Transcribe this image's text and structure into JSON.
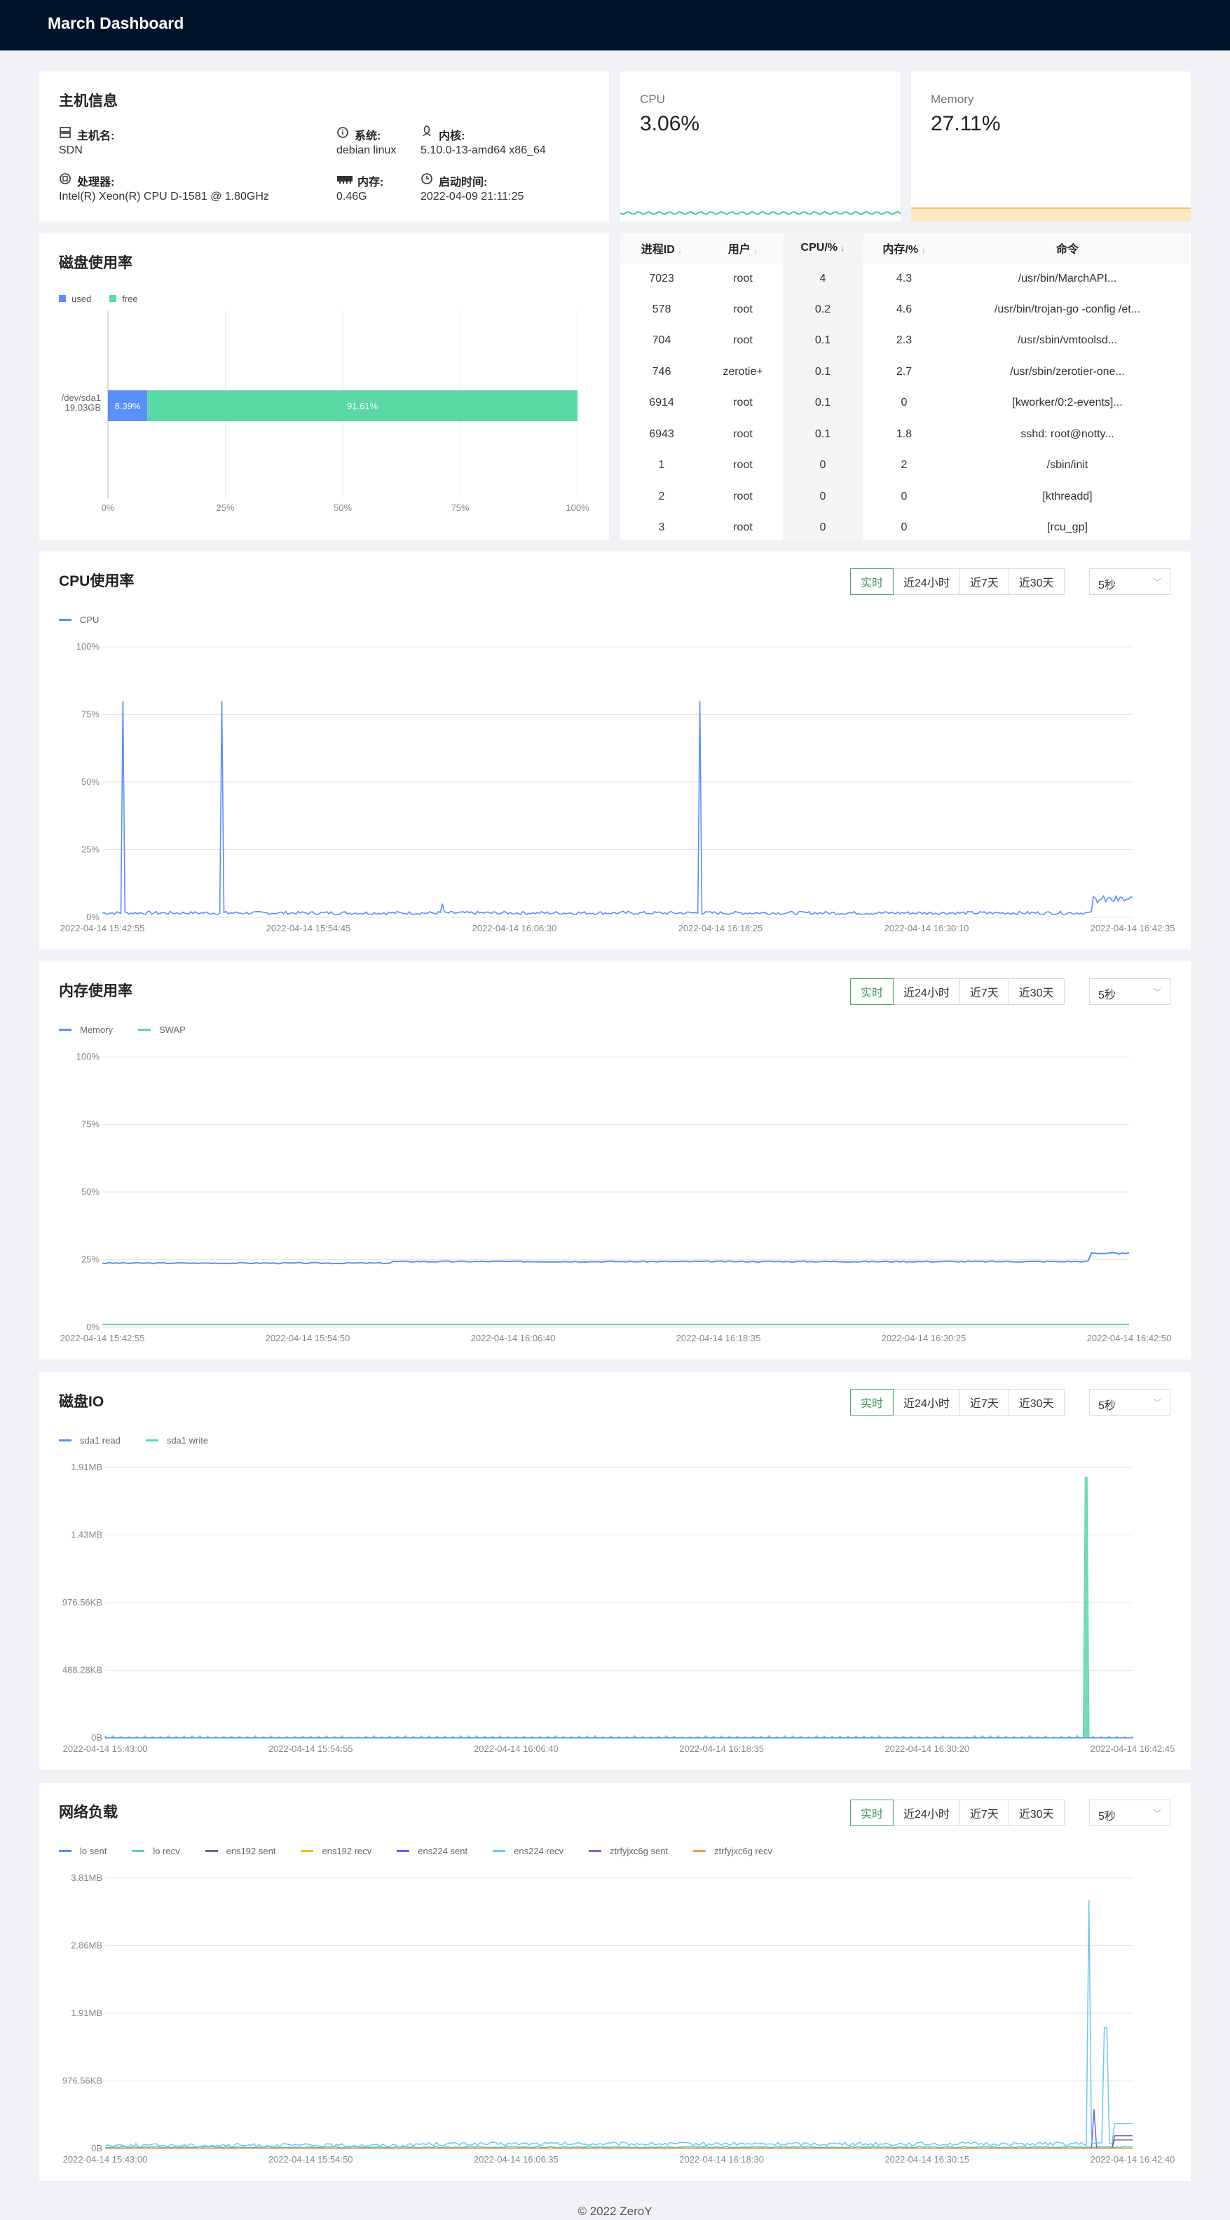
{
  "app": {
    "title": "March Dashboard"
  },
  "host": {
    "title": "主机信息",
    "hostname_label": "主机名:",
    "hostname": "SDN",
    "system_label": "系统:",
    "system": "debian linux",
    "kernel_label": "内核:",
    "kernel": "5.10.0-13-amd64 x86_64",
    "cpu_label": "处理器:",
    "cpu": "Intel(R) Xeon(R) CPU D-1581 @ 1.80GHz",
    "mem_label": "内存:",
    "mem": "0.46G",
    "boot_label": "启动时间:",
    "boot": "2022-04-09 21:11:25"
  },
  "stats": {
    "cpu_label": "CPU",
    "cpu_value": "3.06%",
    "mem_label": "Memory",
    "mem_value": "27.11%",
    "colors": {
      "cpu": "#3ecf8e",
      "mem": "#f5c26b"
    }
  },
  "disk_usage": {
    "title": "磁盘使用率",
    "legend_used": "used",
    "legend_free": "free",
    "device": "/dev/sda1",
    "size": "19.03GB",
    "used_label": "8.39%",
    "free_label": "91.61%",
    "colors": {
      "used": "#5b8ff9",
      "free": "#5ad8a6"
    }
  },
  "process_table": {
    "headers": [
      "进程ID",
      "用户",
      "CPU/%",
      "内存/%",
      "命令"
    ],
    "rows": [
      [
        "7023",
        "root",
        "4",
        "4.3",
        "/usr/bin/MarchAPI..."
      ],
      [
        "578",
        "root",
        "0.2",
        "4.6",
        "/usr/bin/trojan-go -config /et..."
      ],
      [
        "704",
        "root",
        "0.1",
        "2.3",
        "/usr/sbin/vmtoolsd..."
      ],
      [
        "746",
        "zerotie+",
        "0.1",
        "2.7",
        "/usr/sbin/zerotier-one..."
      ],
      [
        "6914",
        "root",
        "0.1",
        "0",
        "[kworker/0:2-events]..."
      ],
      [
        "6943",
        "root",
        "0.1",
        "1.8",
        "sshd: root@notty..."
      ],
      [
        "1",
        "root",
        "0",
        "2",
        "/sbin/init"
      ],
      [
        "2",
        "root",
        "0",
        "0",
        "[kthreadd]"
      ],
      [
        "3",
        "root",
        "0",
        "0",
        "[rcu_gp]"
      ]
    ]
  },
  "controls": {
    "buttons": [
      "实时",
      "近24小时",
      "近7天",
      "近30天"
    ],
    "interval": "5秒"
  },
  "cpu_panel": {
    "title": "CPU使用率"
  },
  "mem_panel": {
    "title": "内存使用率"
  },
  "io_panel": {
    "title": "磁盘IO"
  },
  "net_panel": {
    "title": "网络负载"
  },
  "chart_data": [
    {
      "type": "bar",
      "title": "磁盘使用率",
      "categories": [
        "/dev/sda1 19.03GB"
      ],
      "series": [
        {
          "name": "used",
          "values": [
            8.39
          ]
        },
        {
          "name": "free",
          "values": [
            91.61
          ]
        }
      ],
      "stacked": true,
      "orientation": "horizontal",
      "xlim": [
        0,
        100
      ],
      "xticks": [
        "0%",
        "25%",
        "50%",
        "75%",
        "100%"
      ]
    },
    {
      "type": "line",
      "title": "CPU使用率",
      "series": [
        {
          "name": "CPU",
          "color": "#5b8ff9"
        }
      ],
      "yticks": [
        "0%",
        "25%",
        "50%",
        "75%",
        "100%"
      ],
      "ylim": [
        0,
        100
      ],
      "xticks": [
        "2022-04-14 15:42:55",
        "2022-04-14 15:54:45",
        "2022-04-14 16:06:30",
        "2022-04-14 16:18:25",
        "2022-04-14 16:30:10",
        "2022-04-14 16:42:35"
      ],
      "baseline": 1,
      "spikes": [
        [
          0.02,
          80
        ],
        [
          0.116,
          80
        ],
        [
          0.58,
          80
        ],
        [
          0.33,
          5
        ]
      ],
      "end_level": 5
    },
    {
      "type": "line",
      "title": "内存使用率",
      "series": [
        {
          "name": "Memory",
          "color": "#5b8ff9"
        },
        {
          "name": "SWAP",
          "color": "#5ad8a6"
        }
      ],
      "yticks": [
        "0%",
        "25%",
        "50%",
        "75%",
        "100%"
      ],
      "ylim": [
        0,
        100
      ],
      "xticks": [
        "2022-04-14 15:42:55",
        "2022-04-14 15:54:50",
        "2022-04-14 16:06:40",
        "2022-04-14 16:18:35",
        "2022-04-14 16:30:25",
        "2022-04-14 16:42:50"
      ],
      "memory_level": 24,
      "memory_end": 27,
      "swap_level": 1
    },
    {
      "type": "area",
      "title": "磁盘IO",
      "series": [
        {
          "name": "sda1 read",
          "color": "#5b8ff9"
        },
        {
          "name": "sda1 write",
          "color": "#5ad8a6"
        }
      ],
      "yticks": [
        "0B",
        "488.28KB",
        "976.56KB",
        "1.43MB",
        "1.91MB"
      ],
      "ylim_mb": [
        0,
        1.91
      ],
      "xticks": [
        "2022-04-14 15:43:00",
        "2022-04-14 15:54:55",
        "2022-04-14 16:06:40",
        "2022-04-14 16:18:35",
        "2022-04-14 16:30:20",
        "2022-04-14 16:42:45"
      ],
      "peak_mb": 1.84
    },
    {
      "type": "line",
      "title": "网络负载",
      "series": [
        {
          "name": "lo sent",
          "color": "#5b8ff9"
        },
        {
          "name": "lo recv",
          "color": "#5ad8a6"
        },
        {
          "name": "ens192 sent",
          "color": "#5d7092"
        },
        {
          "name": "ens192 recv",
          "color": "#f6bd16"
        },
        {
          "name": "ens224 sent",
          "color": "#6f5ef9"
        },
        {
          "name": "ens224 recv",
          "color": "#6dc8ec"
        },
        {
          "name": "ztrfyjxc6g sent",
          "color": "#945fb9"
        },
        {
          "name": "ztrfyjxc6g recv",
          "color": "#ff9845"
        }
      ],
      "yticks": [
        "0B",
        "976.56KB",
        "1.91MB",
        "2.86MB",
        "3.81MB"
      ],
      "ylim_mb": [
        0,
        3.81
      ],
      "xticks": [
        "2022-04-14 15:43:00",
        "2022-04-14 15:54:50",
        "2022-04-14 16:06:35",
        "2022-04-14 16:18:30",
        "2022-04-14 16:30:15",
        "2022-04-14 16:42:40"
      ],
      "peak_mb": 3.5
    }
  ],
  "footer": "© 2022 ZeroY"
}
